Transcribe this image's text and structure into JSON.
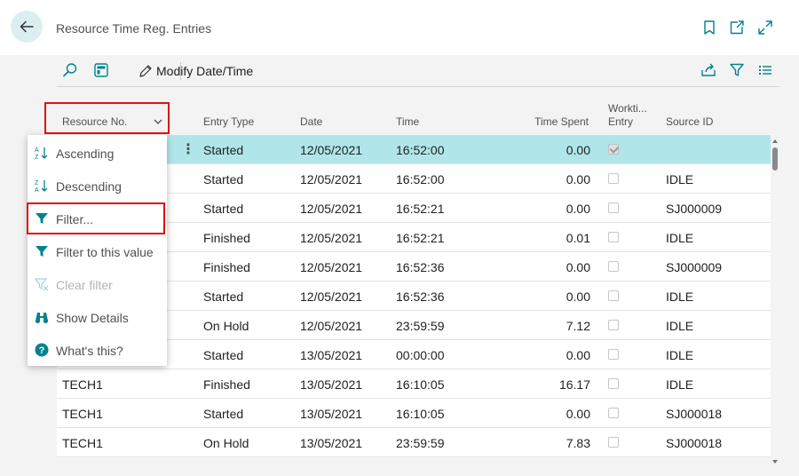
{
  "header": {
    "title": "Resource Time Reg. Entries"
  },
  "toolbar": {
    "modify_label": "Modify Date/Time"
  },
  "columns": {
    "resource_no": "Resource No.",
    "entry_type": "Entry Type",
    "date": "Date",
    "time": "Time",
    "time_spent": "Time Spent",
    "working_entry_line1": "Workti...",
    "working_entry_line2": "Entry",
    "source_id": "Source ID"
  },
  "rows": [
    {
      "resource": "",
      "entry_type": "Started",
      "date": "12/05/2021",
      "time": "16:52:00",
      "time_spent": "0.00",
      "working": true,
      "source_id": ""
    },
    {
      "resource": "",
      "entry_type": "Started",
      "date": "12/05/2021",
      "time": "16:52:00",
      "time_spent": "0.00",
      "working": false,
      "source_id": "IDLE"
    },
    {
      "resource": "",
      "entry_type": "Started",
      "date": "12/05/2021",
      "time": "16:52:21",
      "time_spent": "0.00",
      "working": false,
      "source_id": "SJ000009"
    },
    {
      "resource": "",
      "entry_type": "Finished",
      "date": "12/05/2021",
      "time": "16:52:21",
      "time_spent": "0.01",
      "working": false,
      "source_id": "IDLE"
    },
    {
      "resource": "",
      "entry_type": "Finished",
      "date": "12/05/2021",
      "time": "16:52:36",
      "time_spent": "0.00",
      "working": false,
      "source_id": "SJ000009"
    },
    {
      "resource": "",
      "entry_type": "Started",
      "date": "12/05/2021",
      "time": "16:52:36",
      "time_spent": "0.00",
      "working": false,
      "source_id": "IDLE"
    },
    {
      "resource": "",
      "entry_type": "On Hold",
      "date": "12/05/2021",
      "time": "23:59:59",
      "time_spent": "7.12",
      "working": false,
      "source_id": "IDLE"
    },
    {
      "resource": "",
      "entry_type": "Started",
      "date": "13/05/2021",
      "time": "00:00:00",
      "time_spent": "0.00",
      "working": false,
      "source_id": "IDLE"
    },
    {
      "resource": "TECH1",
      "entry_type": "Finished",
      "date": "13/05/2021",
      "time": "16:10:05",
      "time_spent": "16.17",
      "working": false,
      "source_id": "IDLE"
    },
    {
      "resource": "TECH1",
      "entry_type": "Started",
      "date": "13/05/2021",
      "time": "16:10:05",
      "time_spent": "0.00",
      "working": false,
      "source_id": "SJ000018"
    },
    {
      "resource": "TECH1",
      "entry_type": "On Hold",
      "date": "13/05/2021",
      "time": "23:59:59",
      "time_spent": "7.83",
      "working": false,
      "source_id": "SJ000018"
    }
  ],
  "menu": {
    "ascending": "Ascending",
    "descending": "Descending",
    "filter": "Filter...",
    "filter_value": "Filter to this value",
    "clear_filter": "Clear filter",
    "show_details": "Show Details",
    "whats_this": "What's this?"
  },
  "colors": {
    "accent": "#00838f",
    "selected_row": "#b0e6ea",
    "highlight": "#e01010"
  }
}
